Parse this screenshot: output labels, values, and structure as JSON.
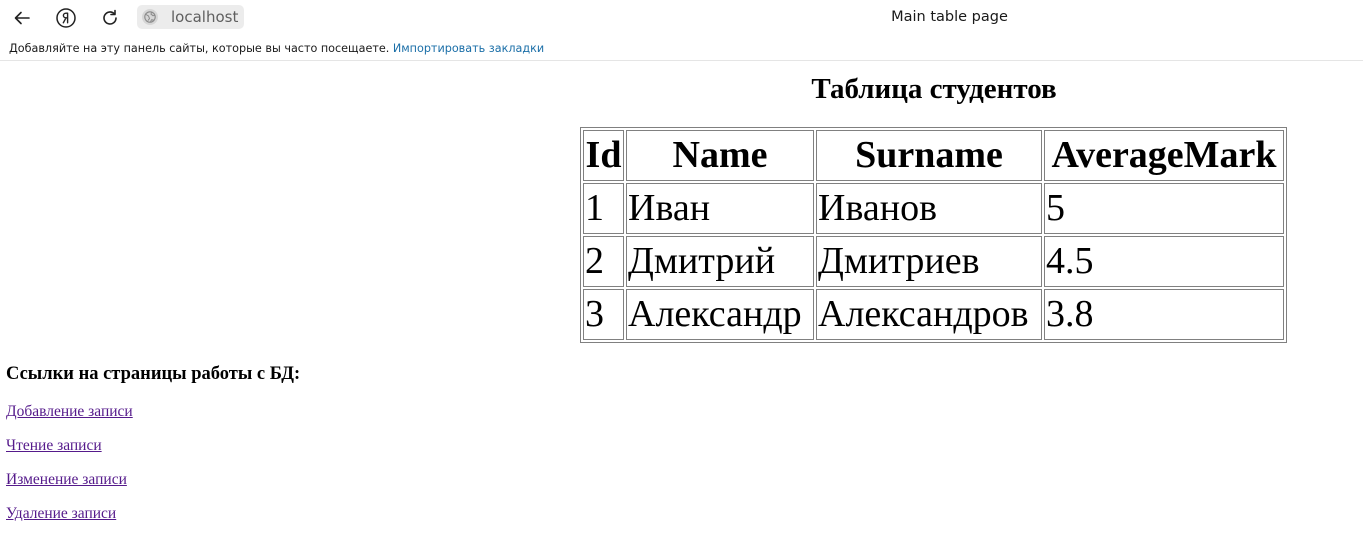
{
  "browser": {
    "address": "localhost",
    "tab_title": "Main table page",
    "bookmarks_bar": {
      "text": "Добавляйте на эту панель сайты, которые вы часто посещаете.",
      "import_link": "Импортировать закладки"
    }
  },
  "page": {
    "heading": "Таблица студентов",
    "table": {
      "columns": [
        "Id",
        "Name",
        "Surname",
        "AverageMark"
      ],
      "rows": [
        [
          "1",
          "Иван",
          "Иванов",
          "5"
        ],
        [
          "2",
          "Дмитрий",
          "Дмитриев",
          "4.5"
        ],
        [
          "3",
          "Александр",
          "Александров",
          "3.8"
        ]
      ]
    },
    "links_heading": "Ссылки на страницы работы с БД:",
    "links": [
      "Добавление записи",
      "Чтение записи",
      "Изменение записи",
      "Удаление записи"
    ]
  }
}
